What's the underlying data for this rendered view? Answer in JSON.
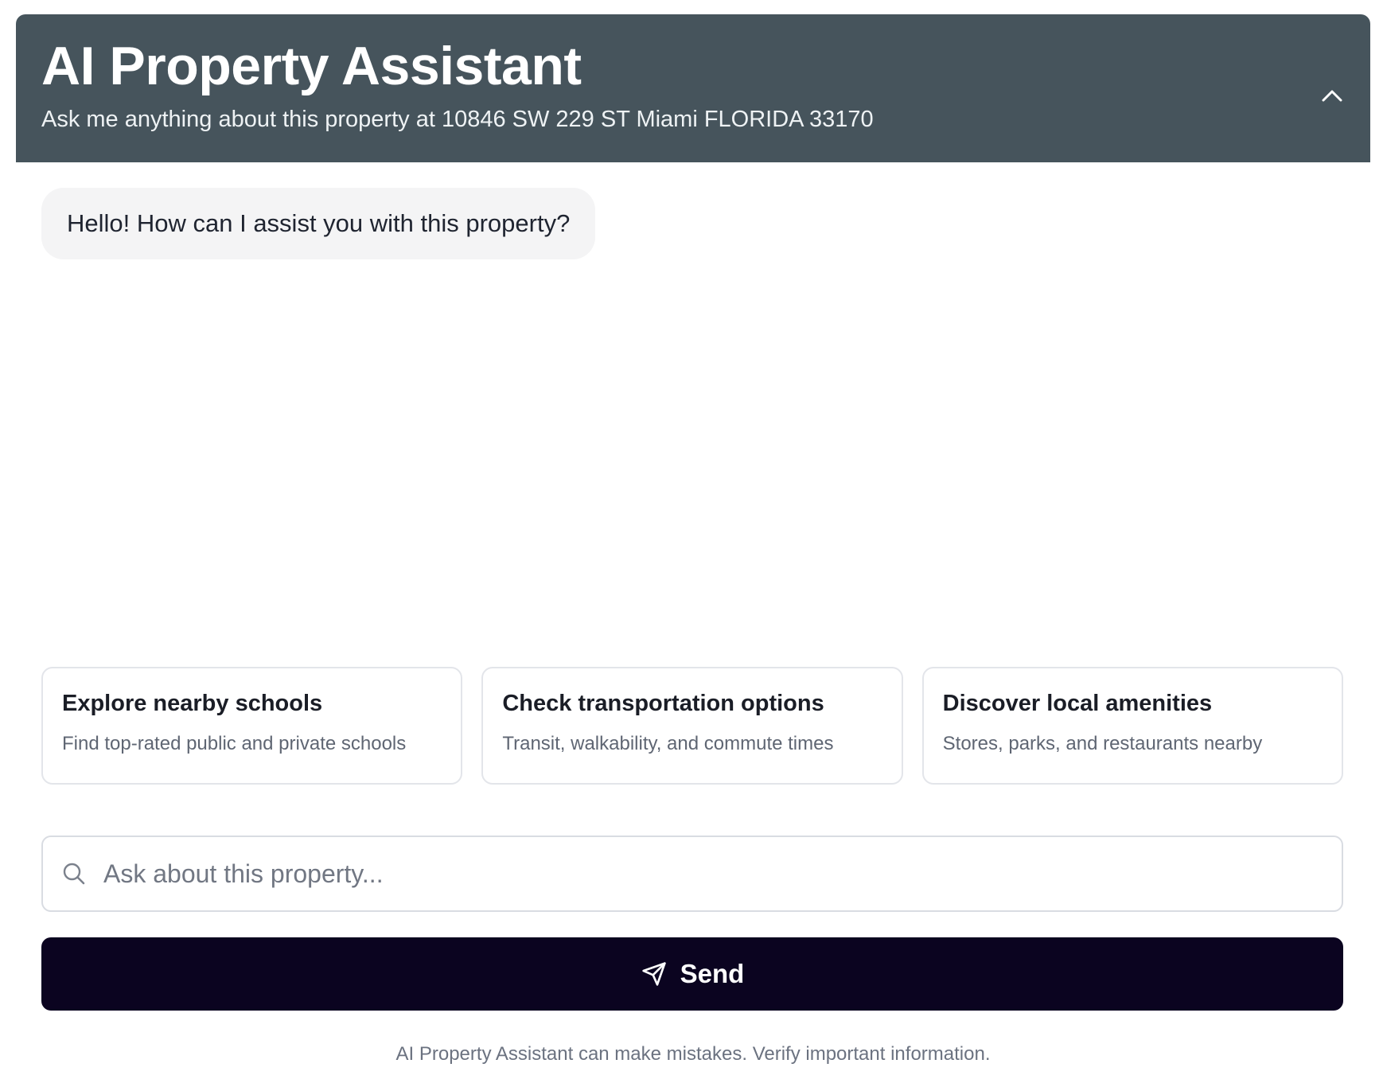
{
  "header": {
    "title": "AI Property Assistant",
    "subtitle": "Ask me anything about this property at 10846 SW 229 ST Miami FLORIDA 33170",
    "collapse_icon": "chevron-up-icon",
    "background_color": "#46545c"
  },
  "messages": [
    {
      "role": "assistant",
      "text": "Hello! How can I assist you with this property?"
    }
  ],
  "suggestions": [
    {
      "title": "Explore nearby schools",
      "description": "Find top-rated public and private schools"
    },
    {
      "title": "Check transportation options",
      "description": "Transit, walkability, and commute times"
    },
    {
      "title": "Discover local amenities",
      "description": "Stores, parks, and restaurants nearby"
    }
  ],
  "input": {
    "placeholder": "Ask about this property...",
    "value": "",
    "icon": "search-icon"
  },
  "send_button": {
    "label": "Send",
    "icon": "send-icon",
    "background_color": "#0b0420"
  },
  "footer": {
    "disclaimer": "AI Property Assistant can make mistakes. Verify important information."
  }
}
